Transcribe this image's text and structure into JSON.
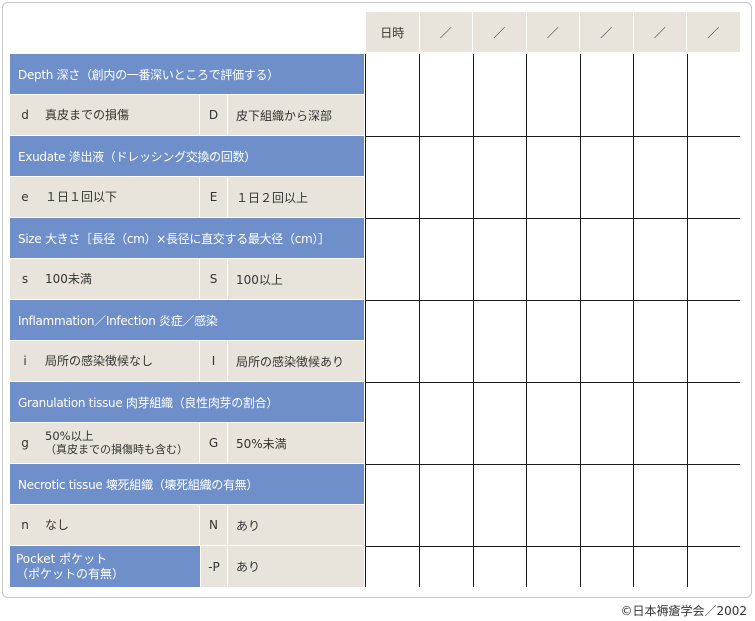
{
  "date_header": {
    "label": "日時",
    "slots": [
      "／",
      "／",
      "／",
      "／",
      "／",
      "／"
    ]
  },
  "sections": [
    {
      "header": "Depth 深さ（創内の一番深いところで評価する）",
      "low_code": "d",
      "low_desc": "真皮までの損傷",
      "high_code": "D",
      "high_desc": "皮下組織から深部"
    },
    {
      "header": "Exudate 滲出液（ドレッシング交換の回数）",
      "low_code": "e",
      "low_desc": "１日１回以下",
      "high_code": "E",
      "high_desc": "１日２回以上"
    },
    {
      "header": "Size 大きさ［長径（cm）×長径に直交する最大径（cm）］",
      "low_code": "s",
      "low_desc": "100未満",
      "high_code": "S",
      "high_desc": "100以上"
    },
    {
      "header": "Inflammation／Infection 炎症／感染",
      "low_code": "i",
      "low_desc": "局所の感染徴候なし",
      "high_code": "I",
      "high_desc": "局所の感染徴候あり"
    },
    {
      "header": "Granulation tissue 肉芽組織（良性肉芽の割合）",
      "low_code": "g",
      "low_desc_line1": "50%以上",
      "low_desc_line2": "（真皮までの損傷時も含む）",
      "high_code": "G",
      "high_desc": "50%未満"
    },
    {
      "header": "Necrotic tissue 壊死組織（壊死組織の有無）",
      "low_code": "n",
      "low_desc": "なし",
      "high_code": "N",
      "high_desc": "あり"
    }
  ],
  "pocket": {
    "header_line1": "Pocket ポケット",
    "header_line2": "（ポケットの有無）",
    "code": "-P",
    "desc": "あり"
  },
  "copyright": "©日本褥瘡学会／2002",
  "colors": {
    "header_bg": "#6e8fca",
    "row_bg": "#e8e4db",
    "grid_line": "#1a1a1a"
  }
}
